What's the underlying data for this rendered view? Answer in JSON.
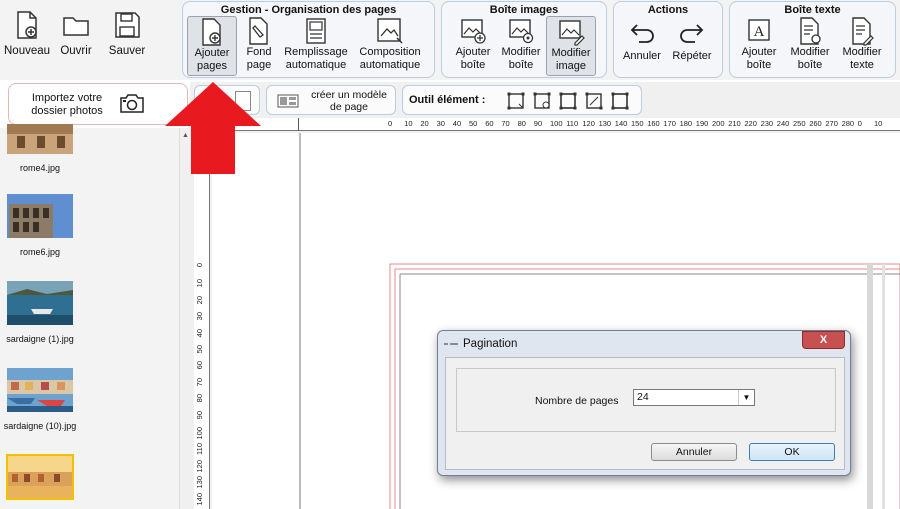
{
  "file_menu": {
    "new": "Nouveau",
    "open": "Ouvrir",
    "save": "Sauver"
  },
  "groups": {
    "pages": {
      "title": "Gestion - Organisation des pages",
      "add_pages": [
        "Ajouter",
        "pages"
      ],
      "background": [
        "Fond",
        "page"
      ],
      "auto_fill": [
        "Remplissage",
        "automatique"
      ],
      "auto_layout": [
        "Composition",
        "automatique"
      ]
    },
    "images": {
      "title": "Boîte images",
      "add_box": [
        "Ajouter",
        "boîte"
      ],
      "edit_box": [
        "Modifier",
        "boîte"
      ],
      "edit_image": [
        "Modifier",
        "image"
      ]
    },
    "actions": {
      "title": "Actions",
      "undo": "Annuler",
      "redo": "Répéter"
    },
    "text": {
      "title": "Boîte texte",
      "add_box": [
        "Ajouter",
        "boîte"
      ],
      "edit_box": [
        "Modifier",
        "boîte"
      ],
      "edit_text": [
        "Modifier",
        "texte"
      ]
    }
  },
  "import": {
    "label": [
      "Importez votre",
      "dossier photos"
    ]
  },
  "toolbar2": {
    "template": [
      "créer un modèle",
      "de page"
    ],
    "element_tool": "Outil élément :"
  },
  "photos": [
    {
      "name": "rome4.jpg"
    },
    {
      "name": "rome6.jpg"
    },
    {
      "name": "sardaigne (1).jpg"
    },
    {
      "name": "sardaigne (10).jpg"
    }
  ],
  "ruler_h": [
    "0",
    "10",
    "20",
    "30",
    "40",
    "50",
    "60",
    "70",
    "80",
    "90",
    "100",
    "110",
    "120",
    "130",
    "140",
    "150",
    "160",
    "170",
    "180",
    "190",
    "200",
    "210",
    "220",
    "230",
    "240",
    "250",
    "260",
    "270",
    "280",
    "0",
    "10"
  ],
  "ruler_v": [
    "0",
    "10",
    "20",
    "30",
    "40",
    "50",
    "60",
    "70",
    "80",
    "90",
    "100",
    "110",
    "120",
    "130",
    "140"
  ],
  "dialog": {
    "title": "Pagination",
    "close": "X",
    "pages_label": "Nombre de pages",
    "pages_value": "24",
    "cancel": "Annuler",
    "ok": "OK"
  },
  "colors": {
    "arrow": "#e8191f",
    "ribbon_border": "#b9cde3",
    "page_margin": "#e88a8a",
    "close_button": "#c75050"
  }
}
